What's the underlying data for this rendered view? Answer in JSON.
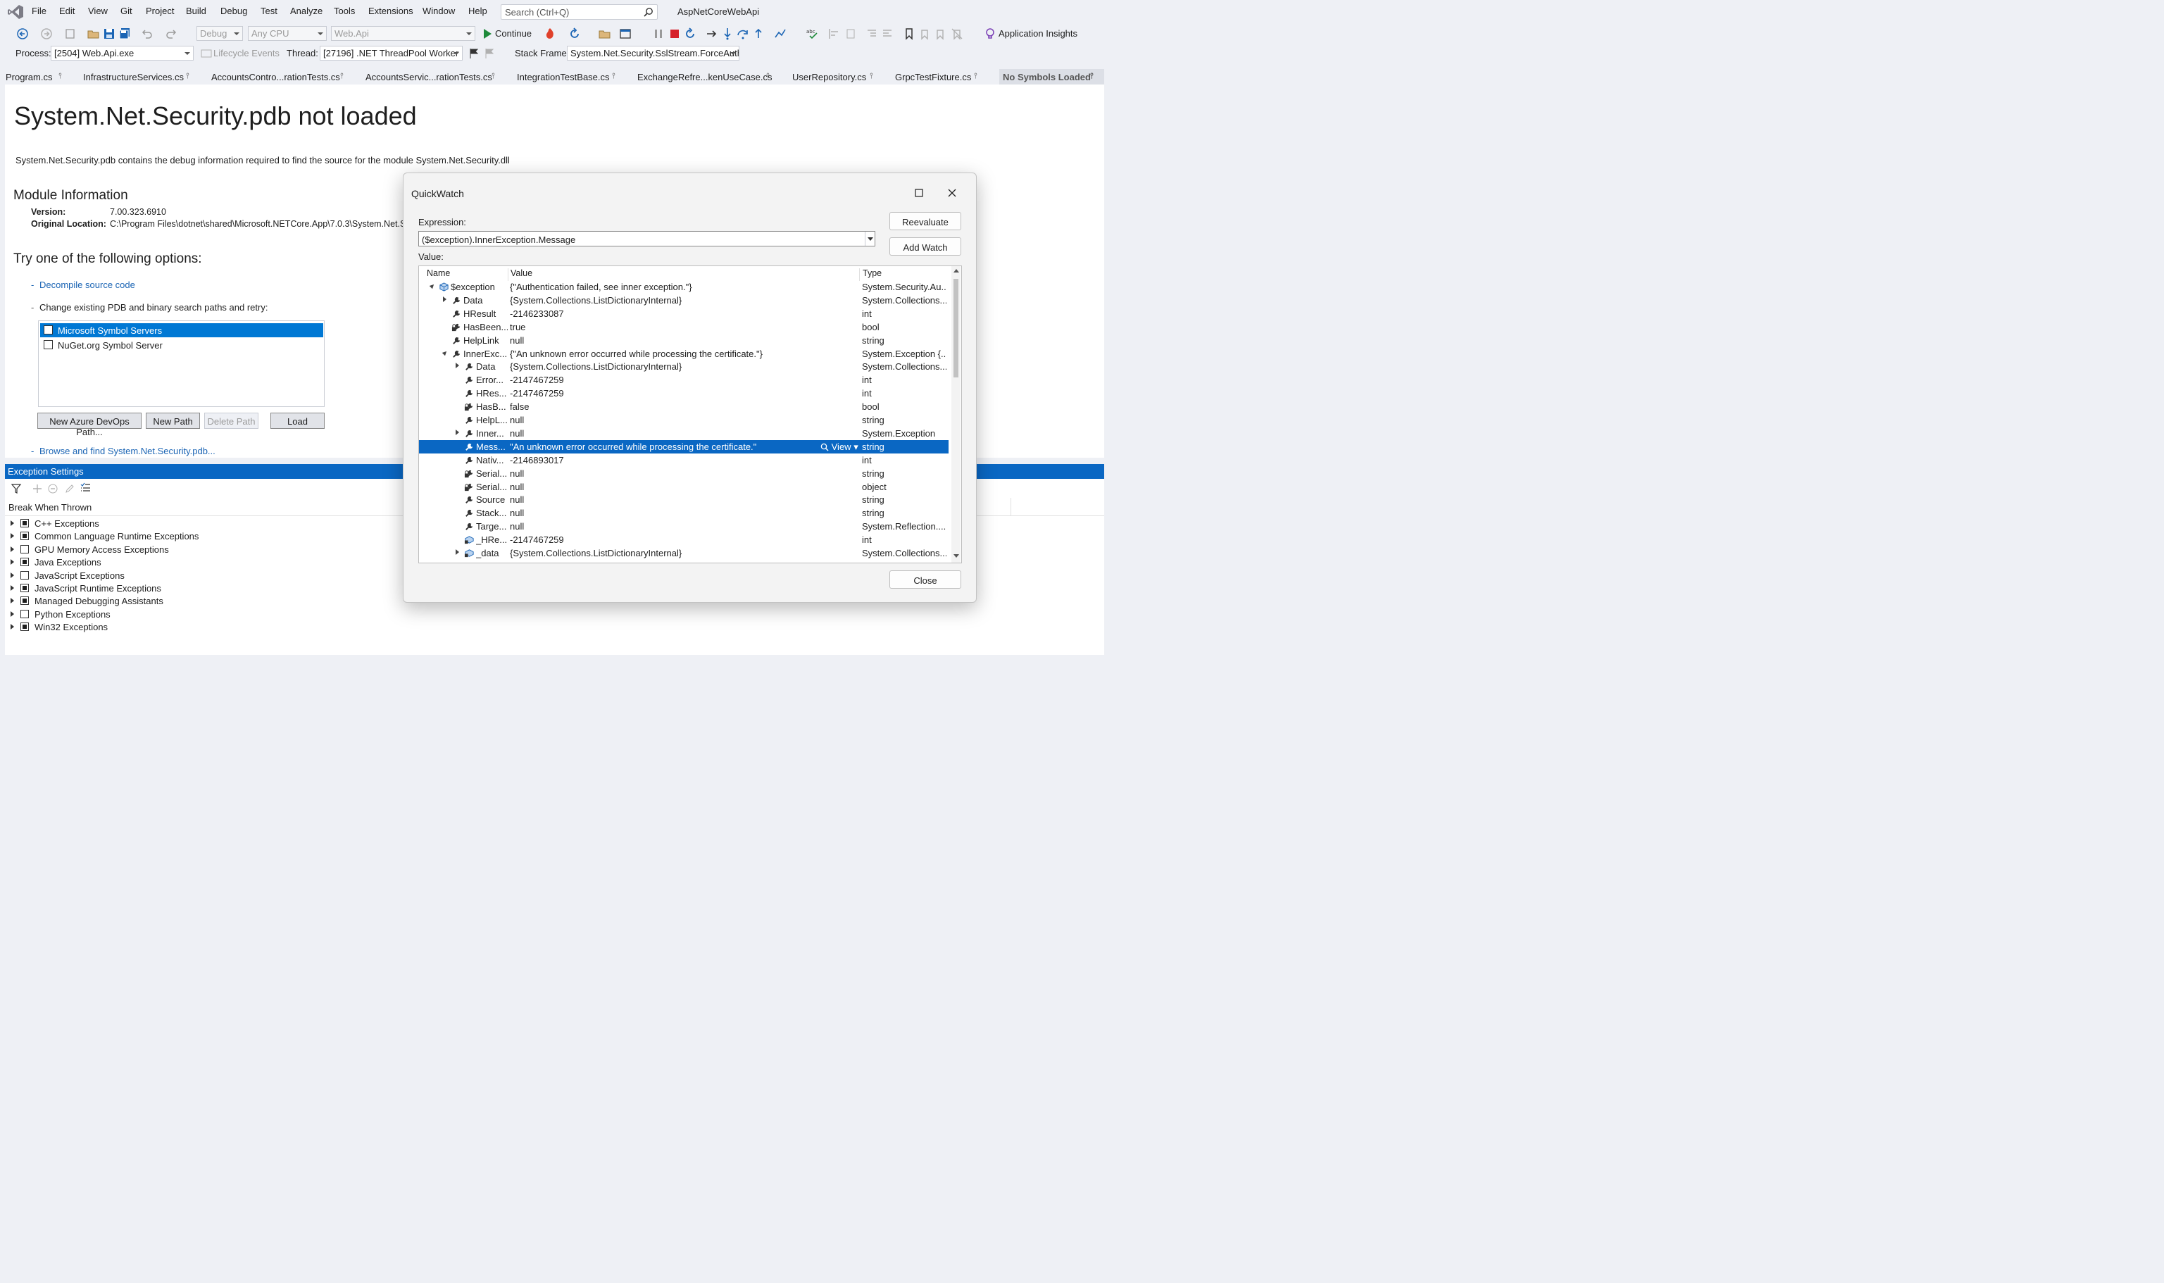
{
  "menubar": {
    "items": [
      "File",
      "Edit",
      "View",
      "Git",
      "Project",
      "Build",
      "Debug",
      "Test",
      "Analyze",
      "Tools",
      "Extensions",
      "Window",
      "Help"
    ],
    "search_placeholder": "Search (Ctrl+Q)",
    "solution_name": "AspNetCoreWebApi"
  },
  "toolbar": {
    "config": "Debug",
    "platform": "Any CPU",
    "startup": "Web.Api",
    "continue_label": "Continue",
    "app_insights_label": "Application Insights"
  },
  "debug_location": {
    "process_label": "Process:",
    "process_value": "[2504] Web.Api.exe",
    "lifecycle_label": "Lifecycle Events",
    "thread_label": "Thread:",
    "thread_value": "[27196] .NET ThreadPool Worker",
    "stackframe_label": "Stack Frame:",
    "stackframe_value": "System.Net.Security.SslStream.ForceAuthe"
  },
  "tabs": [
    {
      "label": "Program.cs"
    },
    {
      "label": "InfrastructureServices.cs"
    },
    {
      "label": "AccountsContro...rationTests.cs"
    },
    {
      "label": "AccountsServic...rationTests.cs"
    },
    {
      "label": "IntegrationTestBase.cs"
    },
    {
      "label": "ExchangeRefre...kenUseCase.cs"
    },
    {
      "label": "UserRepository.cs"
    },
    {
      "label": "GrpcTestFixture.cs"
    },
    {
      "label": "No Symbols Loaded"
    }
  ],
  "doc": {
    "title": "System.Net.Security.pdb not loaded",
    "description": "System.Net.Security.pdb contains the debug information required to find the source for the module System.Net.Security.dll",
    "module_heading": "Module Information",
    "version_label": "Version:",
    "version_value": "7.00.323.6910",
    "location_label": "Original Location:",
    "location_value": "C:\\Program Files\\dotnet\\shared\\Microsoft.NETCore.App\\7.0.3\\System.Net.Sec",
    "options_heading": "Try one of the following options:",
    "decompile_link": "Decompile source code",
    "change_paths_text": "Change existing PDB and binary search paths and retry:",
    "search_paths": [
      {
        "label": "Microsoft Symbol Servers",
        "checked": false,
        "selected": true
      },
      {
        "label": "NuGet.org Symbol Server",
        "checked": false,
        "selected": false
      }
    ],
    "btn_new_azure": "New Azure DevOps Path...",
    "btn_new_path": "New Path",
    "btn_delete_path": "Delete Path",
    "btn_load": "Load",
    "browse_link": "Browse and find System.Net.Security.pdb..."
  },
  "exceptions": {
    "header": "Exception Settings",
    "column": "Break When Thrown",
    "rows": [
      {
        "label": "C++ Exceptions",
        "state": "partial"
      },
      {
        "label": "Common Language Runtime Exceptions",
        "state": "partial"
      },
      {
        "label": "GPU Memory Access Exceptions",
        "state": "none"
      },
      {
        "label": "Java Exceptions",
        "state": "partial"
      },
      {
        "label": "JavaScript Exceptions",
        "state": "none"
      },
      {
        "label": "JavaScript Runtime Exceptions",
        "state": "partial"
      },
      {
        "label": "Managed Debugging Assistants",
        "state": "partial"
      },
      {
        "label": "Python Exceptions",
        "state": "none"
      },
      {
        "label": "Win32 Exceptions",
        "state": "partial"
      }
    ]
  },
  "quickwatch": {
    "title": "QuickWatch",
    "expression_label": "Expression:",
    "expression_value": "($exception).InnerException.Message",
    "value_label": "Value:",
    "btn_reevaluate": "Reevaluate",
    "btn_add_watch": "Add Watch",
    "btn_close": "Close",
    "col_name": "Name",
    "col_value": "Value",
    "col_type": "Type",
    "view_label": "View",
    "rows": [
      {
        "indent": 0,
        "expander": "open",
        "icon": "object-icon",
        "name": "$exception",
        "value": "{\"Authentication failed, see inner exception.\"}",
        "type": "System.Security.Au..."
      },
      {
        "indent": 1,
        "expander": "collapsed",
        "icon": "wrench-icon",
        "name": "Data",
        "value": "{System.Collections.ListDictionaryInternal}",
        "type": "System.Collections...."
      },
      {
        "indent": 1,
        "expander": "",
        "icon": "wrench-icon",
        "name": "HResult",
        "value": "-2146233087",
        "type": "int"
      },
      {
        "indent": 1,
        "expander": "",
        "icon": "locked-wrench-icon",
        "name": "HasBeen...",
        "value": "true",
        "type": "bool"
      },
      {
        "indent": 1,
        "expander": "",
        "icon": "wrench-icon",
        "name": "HelpLink",
        "value": "null",
        "type": "string"
      },
      {
        "indent": 1,
        "expander": "open",
        "icon": "wrench-icon",
        "name": "InnerExc...",
        "value": "{\"An unknown error occurred while processing the certificate.\"}",
        "type": "System.Exception {..."
      },
      {
        "indent": 2,
        "expander": "collapsed",
        "icon": "wrench-icon",
        "name": "Data",
        "value": "{System.Collections.ListDictionaryInternal}",
        "type": "System.Collections...."
      },
      {
        "indent": 2,
        "expander": "",
        "icon": "wrench-icon",
        "name": "Error...",
        "value": "-2147467259",
        "type": "int"
      },
      {
        "indent": 2,
        "expander": "",
        "icon": "wrench-icon",
        "name": "HRes...",
        "value": "-2147467259",
        "type": "int"
      },
      {
        "indent": 2,
        "expander": "",
        "icon": "locked-wrench-icon",
        "name": "HasB...",
        "value": "false",
        "type": "bool"
      },
      {
        "indent": 2,
        "expander": "",
        "icon": "wrench-icon",
        "name": "HelpL...",
        "value": "null",
        "type": "string"
      },
      {
        "indent": 2,
        "expander": "collapsed",
        "icon": "wrench-icon",
        "name": "Inner...",
        "value": "null",
        "type": "System.Exception"
      },
      {
        "indent": 2,
        "expander": "",
        "icon": "wrench-icon",
        "name": "Mess...",
        "value": "\"An unknown error occurred while processing the certificate.\"",
        "type": "string",
        "selected": true
      },
      {
        "indent": 2,
        "expander": "",
        "icon": "wrench-icon",
        "name": "Nativ...",
        "value": "-2146893017",
        "type": "int"
      },
      {
        "indent": 2,
        "expander": "",
        "icon": "locked-wrench-icon",
        "name": "Serial...",
        "value": "null",
        "type": "string"
      },
      {
        "indent": 2,
        "expander": "",
        "icon": "locked-wrench-icon",
        "name": "Serial...",
        "value": "null",
        "type": "object"
      },
      {
        "indent": 2,
        "expander": "",
        "icon": "wrench-icon",
        "name": "Source",
        "value": "null",
        "type": "string"
      },
      {
        "indent": 2,
        "expander": "",
        "icon": "wrench-icon",
        "name": "Stack...",
        "value": "null",
        "type": "string"
      },
      {
        "indent": 2,
        "expander": "",
        "icon": "wrench-icon",
        "name": "Targe...",
        "value": "null",
        "type": "System.Reflection...."
      },
      {
        "indent": 2,
        "expander": "",
        "icon": "field-icon",
        "name": "_HRe...",
        "value": "-2147467259",
        "type": "int"
      },
      {
        "indent": 2,
        "expander": "collapsed",
        "icon": "field-icon",
        "name": "_data",
        "value": "{System.Collections.ListDictionaryInternal}",
        "type": "System.Collections...."
      }
    ]
  }
}
